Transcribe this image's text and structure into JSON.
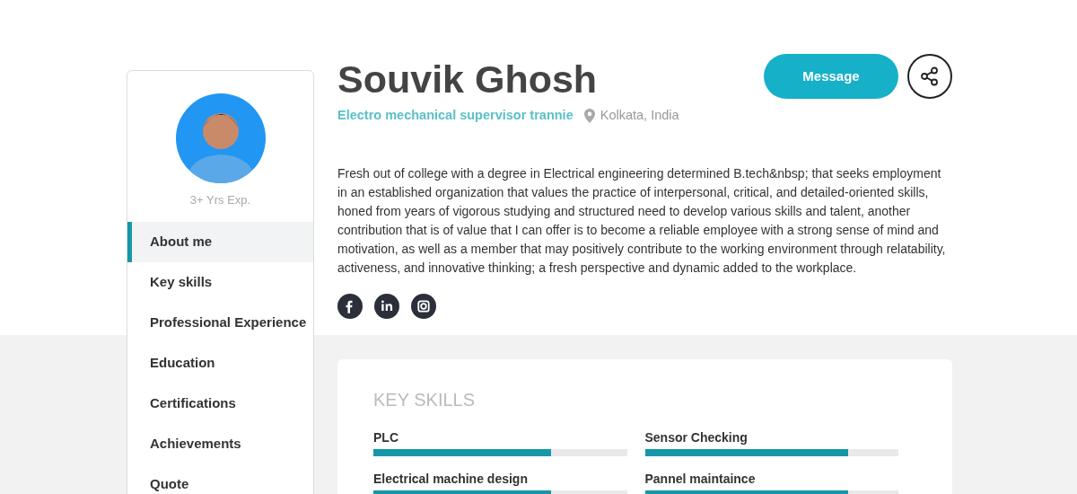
{
  "profile": {
    "experience": "3+ Yrs Exp.",
    "name": "Souvik Ghosh",
    "role": "Electro mechanical supervisor trannie",
    "location": "Kolkata, India",
    "about": "Fresh out of college with a degree in Electrical engineering determined B.tech&nbsp; that seeks employment in an established organization that values the practice of interpersonal, critical, and detailed-oriented skills, honed from years of vigorous studying and structured need to develop various skills and talent, another contribution that is of value that I can offer is to become a reliable employee with a strong sense of mind and motivation, as well as a member that may positively contribute to the working environment through relatability, activeness, and innovative thinking; a fresh perspective and dynamic added to the workplace.",
    "message_button": "Message",
    "social": [
      {
        "kind": "facebook"
      },
      {
        "kind": "linkedin"
      },
      {
        "kind": "instagram"
      }
    ]
  },
  "sidebar": {
    "items": [
      {
        "label": "About me",
        "selected": true
      },
      {
        "label": "Key skills",
        "selected": false
      },
      {
        "label": "Professional Experience",
        "selected": false
      },
      {
        "label": "Education",
        "selected": false
      },
      {
        "label": "Certifications",
        "selected": false
      },
      {
        "label": "Achievements",
        "selected": false
      },
      {
        "label": "Quote",
        "selected": false
      }
    ]
  },
  "key_skills": {
    "title": "KEY SKILLS",
    "skills": [
      {
        "name": "PLC",
        "level": 0.7
      },
      {
        "name": "Sensor Checking",
        "level": 0.8
      },
      {
        "name": "Electrical machine design",
        "level": 0.7
      },
      {
        "name": "Pannel maintaince",
        "level": 0.8
      }
    ]
  }
}
